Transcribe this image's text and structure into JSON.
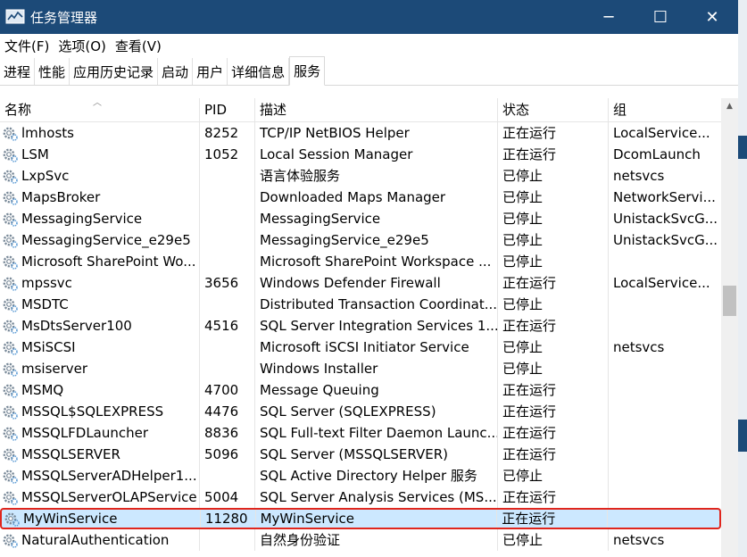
{
  "window": {
    "title": "任务管理器",
    "minimize": "─",
    "maximize": "☐",
    "close": "✕"
  },
  "menu": [
    "文件(F)",
    "选项(O)",
    "查看(V)"
  ],
  "tabs": [
    "进程",
    "性能",
    "应用历史记录",
    "启动",
    "用户",
    "详细信息",
    "服务"
  ],
  "active_tab": "服务",
  "columns": {
    "name": "名称",
    "pid": "PID",
    "desc": "描述",
    "status": "状态",
    "group": "组"
  },
  "rows": [
    {
      "name": "lmhosts",
      "pid": "8252",
      "desc": "TCP/IP NetBIOS Helper",
      "status": "正在运行",
      "group": "LocalService..."
    },
    {
      "name": "LSM",
      "pid": "1052",
      "desc": "Local Session Manager",
      "status": "正在运行",
      "group": "DcomLaunch"
    },
    {
      "name": "LxpSvc",
      "pid": "",
      "desc": "语言体验服务",
      "status": "已停止",
      "group": "netsvcs"
    },
    {
      "name": "MapsBroker",
      "pid": "",
      "desc": "Downloaded Maps Manager",
      "status": "已停止",
      "group": "NetworkServi..."
    },
    {
      "name": "MessagingService",
      "pid": "",
      "desc": "MessagingService",
      "status": "已停止",
      "group": "UnistackSvcG..."
    },
    {
      "name": "MessagingService_e29e5",
      "pid": "",
      "desc": "MessagingService_e29e5",
      "status": "已停止",
      "group": "UnistackSvcG..."
    },
    {
      "name": "Microsoft SharePoint Wo...",
      "pid": "",
      "desc": "Microsoft SharePoint Workspace ...",
      "status": "已停止",
      "group": ""
    },
    {
      "name": "mpssvc",
      "pid": "3656",
      "desc": "Windows Defender Firewall",
      "status": "正在运行",
      "group": "LocalService..."
    },
    {
      "name": "MSDTC",
      "pid": "",
      "desc": "Distributed Transaction Coordinat...",
      "status": "已停止",
      "group": ""
    },
    {
      "name": "MsDtsServer100",
      "pid": "4516",
      "desc": "SQL Server Integration Services 1...",
      "status": "正在运行",
      "group": ""
    },
    {
      "name": "MSiSCSI",
      "pid": "",
      "desc": "Microsoft iSCSI Initiator Service",
      "status": "已停止",
      "group": "netsvcs"
    },
    {
      "name": "msiserver",
      "pid": "",
      "desc": "Windows Installer",
      "status": "已停止",
      "group": ""
    },
    {
      "name": "MSMQ",
      "pid": "4700",
      "desc": "Message Queuing",
      "status": "正在运行",
      "group": ""
    },
    {
      "name": "MSSQL$SQLEXPRESS",
      "pid": "4476",
      "desc": "SQL Server (SQLEXPRESS)",
      "status": "正在运行",
      "group": ""
    },
    {
      "name": "MSSQLFDLauncher",
      "pid": "8836",
      "desc": "SQL Full-text Filter Daemon Launc...",
      "status": "正在运行",
      "group": ""
    },
    {
      "name": "MSSQLSERVER",
      "pid": "5096",
      "desc": "SQL Server (MSSQLSERVER)",
      "status": "正在运行",
      "group": ""
    },
    {
      "name": "MSSQLServerADHelper1...",
      "pid": "",
      "desc": "SQL Active Directory Helper 服务",
      "status": "已停止",
      "group": ""
    },
    {
      "name": "MSSQLServerOLAPService",
      "pid": "5004",
      "desc": "SQL Server Analysis Services (MS...",
      "status": "正在运行",
      "group": ""
    },
    {
      "name": "MyWinService",
      "pid": "11280",
      "desc": "MyWinService",
      "status": "正在运行",
      "group": "",
      "selected": true
    },
    {
      "name": "NaturalAuthentication",
      "pid": "",
      "desc": "自然身份验证",
      "status": "已停止",
      "group": "netsvcs"
    }
  ],
  "colors": {
    "titlebar": "#1c4a78",
    "selected_row": "#cce8ff",
    "highlight_border": "#e0261d"
  }
}
